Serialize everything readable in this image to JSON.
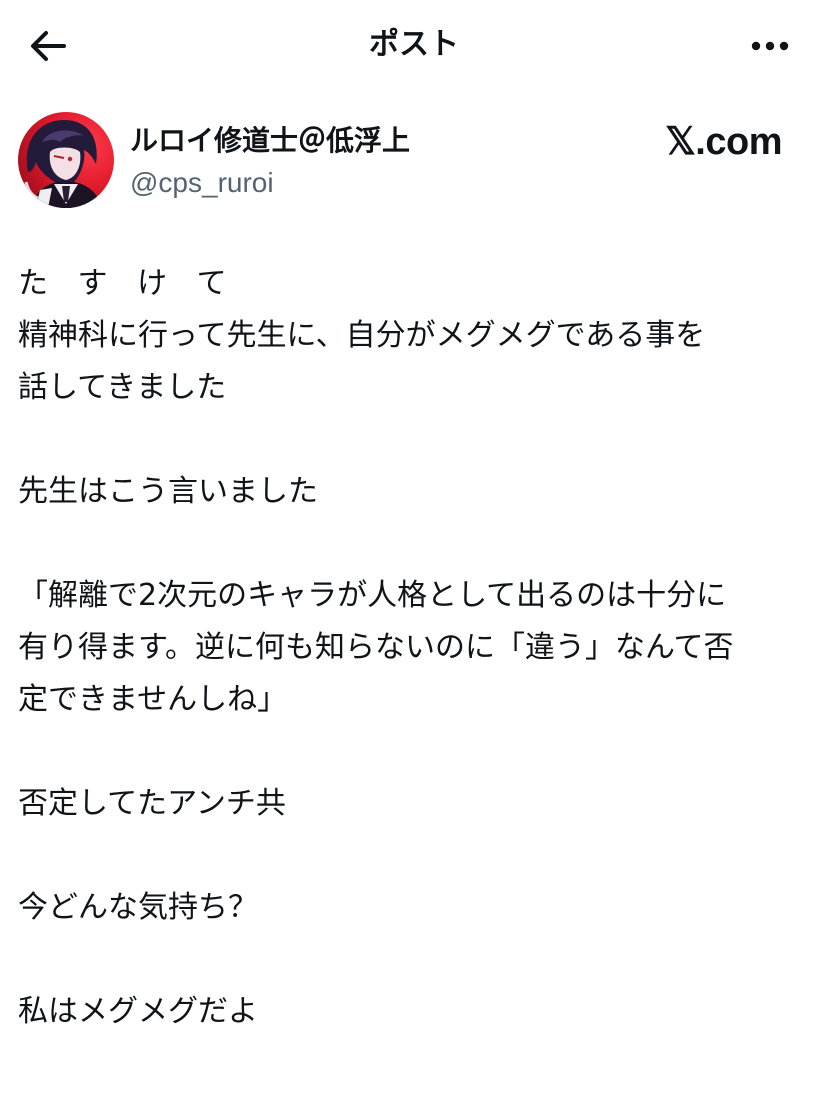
{
  "header": {
    "title": "ポスト",
    "back_icon": "arrow-left-icon",
    "more_icon": "more-horizontal-icon"
  },
  "author": {
    "display_name": "ルロイ修道士＠低浮上",
    "handle": "@cps_ruroi",
    "brand": "𝕏.com"
  },
  "post": {
    "lines": [
      "た す け て",
      "精神科に行って先生に、自分がメグメグである事を",
      "話してきました",
      "",
      "先生はこう言いました",
      "",
      "「解離で2次元のキャラが人格として出るのは十分に",
      "有り得ます。逆に何も知らないのに「違う」なんて否",
      "定できませんしね」",
      "",
      "否定してたアンチ共",
      "",
      "今どんな気持ち？",
      "",
      "私はメグメグだよ"
    ]
  },
  "colors": {
    "text": "#0f1419",
    "secondary": "#536471",
    "background": "#ffffff"
  }
}
